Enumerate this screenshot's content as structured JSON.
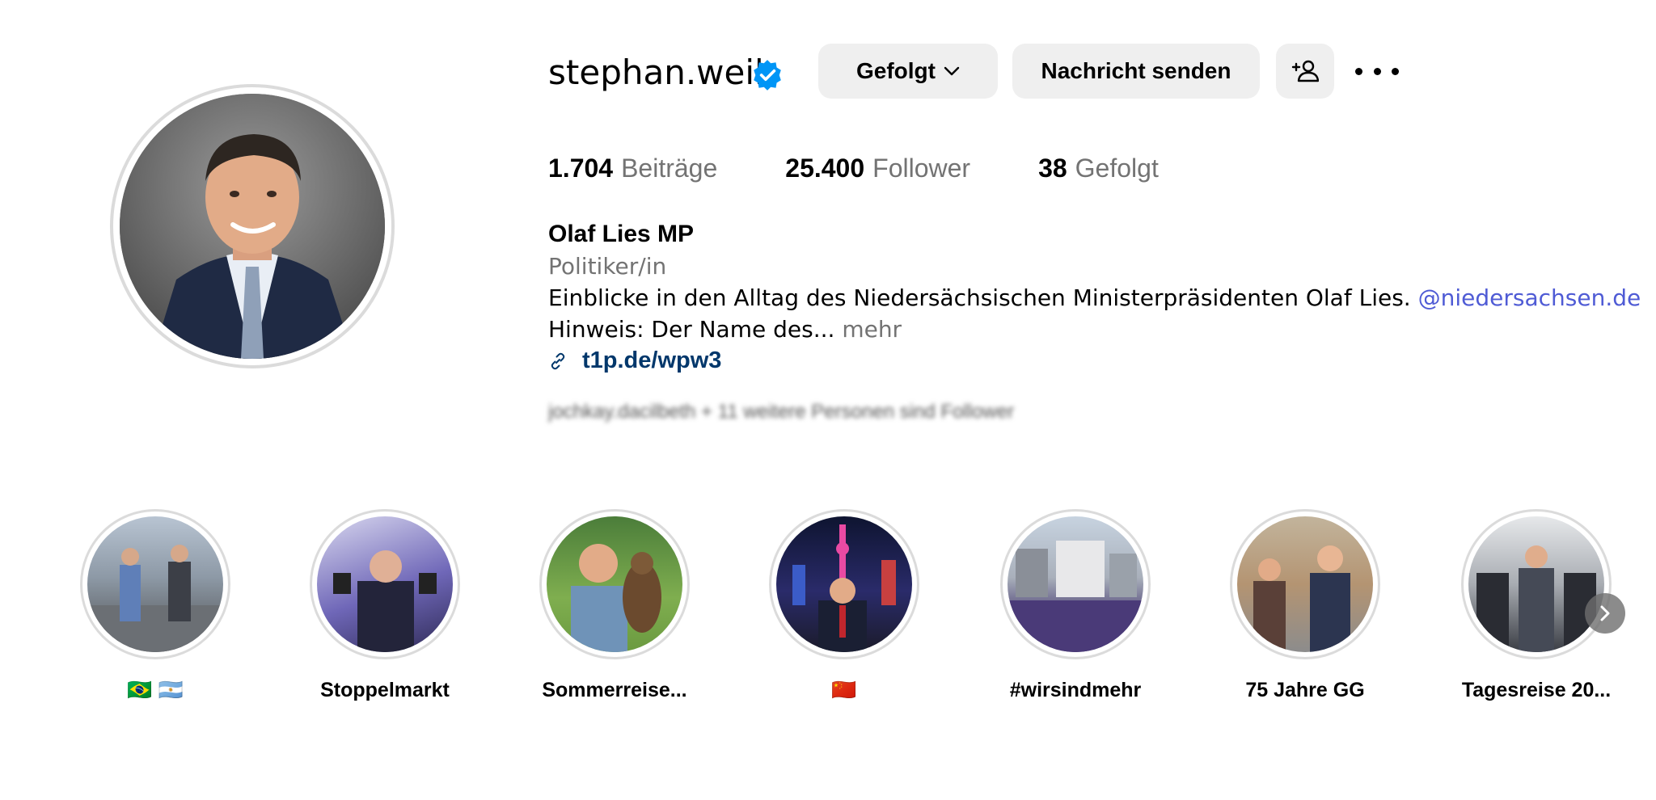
{
  "profile": {
    "username": "stephan.weil",
    "verified_icon": "verified-badge-icon",
    "following_button_label": "Gefolgt",
    "message_button_label": "Nachricht senden",
    "suggest_icon": "add-person-icon",
    "more_icon": "more-options-icon"
  },
  "stats": [
    {
      "count": "1.704",
      "label": "Beiträge"
    },
    {
      "count": "25.400",
      "label": "Follower"
    },
    {
      "count": "38",
      "label": "Gefolgt"
    }
  ],
  "bio": {
    "name": "Olaf Lies MP",
    "category": "Politiker/in",
    "text": "Einblicke in den Alltag des Niedersächsischen Ministerpräsidenten Olaf Lies.",
    "mention": "@niedersachsen.de",
    "line2": "Hinweis: Der Name des...",
    "more_label": "mehr",
    "link_icon": "link-icon",
    "link": "t1p.de/wpw3"
  },
  "followed_by_blurred": "jochkay.dacilbeth + 11 weitere Personen sind Follower",
  "highlights": [
    {
      "label": "🇧🇷 🇦🇷"
    },
    {
      "label": "Stoppelmarkt"
    },
    {
      "label": "Sommerreise..."
    },
    {
      "label": "🇨🇳"
    },
    {
      "label": "#wirsindmehr"
    },
    {
      "label": "75 Jahre GG"
    },
    {
      "label": "Tagesreise 20..."
    }
  ],
  "colors": {
    "verified": "#0095f6",
    "button_bg": "#efefef",
    "secondary_text": "#737373",
    "mention": "#4f5bd5",
    "link": "#00376b"
  }
}
